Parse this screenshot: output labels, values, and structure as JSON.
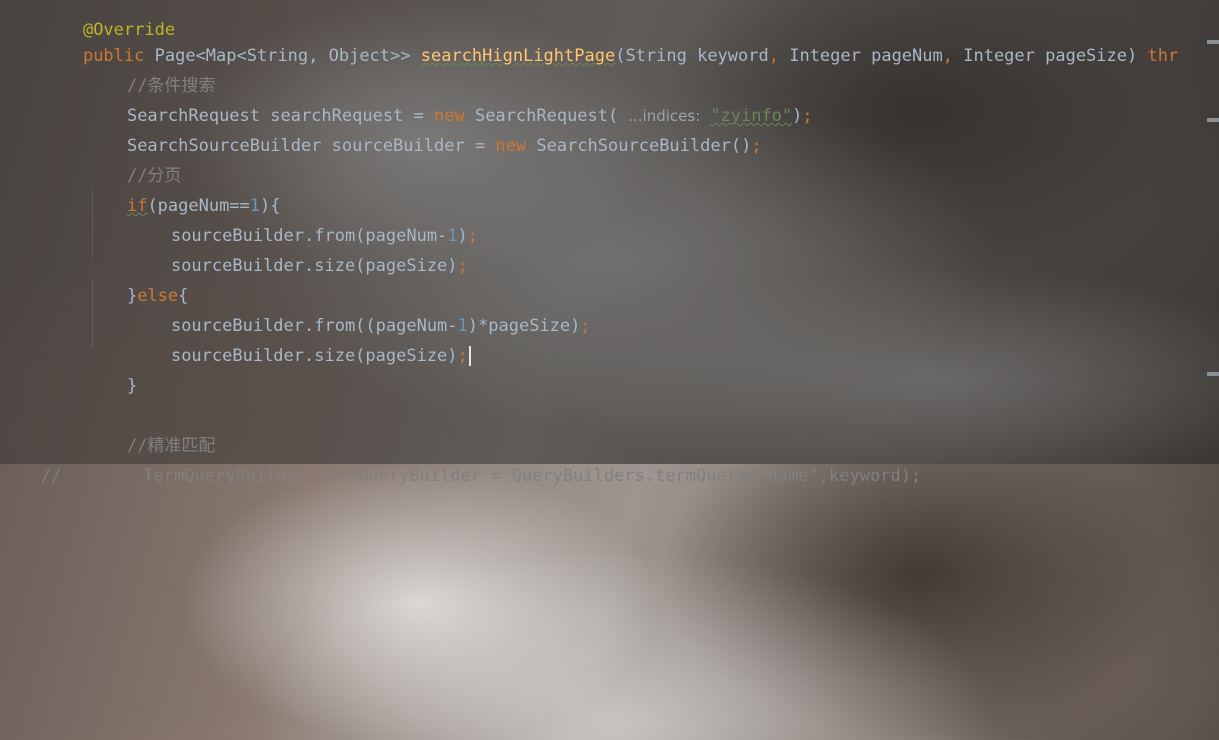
{
  "editor": {
    "lines": [
      {
        "id": "l0",
        "top_text": "@Override"
      },
      {
        "id": "l1"
      },
      {
        "id": "l2"
      },
      {
        "id": "l3"
      },
      {
        "id": "l4"
      },
      {
        "id": "l5"
      },
      {
        "id": "l6"
      },
      {
        "id": "l7"
      },
      {
        "id": "l8"
      },
      {
        "id": "l9"
      },
      {
        "id": "l10"
      },
      {
        "id": "l11"
      },
      {
        "id": "l12"
      },
      {
        "id": "l13"
      },
      {
        "id": "l14"
      }
    ],
    "annotation": "@Override",
    "line1": {
      "public": "public",
      "page_type": "Page<Map<String, Object>> ",
      "method": "searchHignLightPage",
      "params_open": "(String keyword",
      "comma1": ", ",
      "param2": "Integer pageNum",
      "comma2": ", ",
      "param3": "Integer pageSize) ",
      "throws": "thr"
    },
    "comment_search": "//条件搜索",
    "line3": {
      "text1": "SearchRequest searchRequest = ",
      "new": "new",
      "text2": " SearchRequest(",
      "hint": "...indices:",
      "string": "\"zyinfo\"",
      "close": ")",
      "semi": ";"
    },
    "line4": {
      "text1": "SearchSourceBuilder sourceBuilder = ",
      "new": "new",
      "text2": " SearchSourceBuilder()",
      "semi": ";"
    },
    "comment_page": "//分页",
    "line6": {
      "if": "if",
      "text1": "(pageNum==",
      "num": "1",
      "text2": "){"
    },
    "line7": {
      "text1": "sourceBuilder.from(pageNum-",
      "num": "1",
      "text2": ")",
      "semi": ";"
    },
    "line8": {
      "text1": "sourceBuilder.size(pageSize)",
      "semi": ";"
    },
    "line9": {
      "brace": "}",
      "else": "else",
      "open": "{"
    },
    "line10": {
      "text1": "sourceBuilder.from((pageNum-",
      "num": "1",
      "text2": ")*pageSize)",
      "semi": ";"
    },
    "line11": {
      "text1": "sourceBuilder.size(pageSize)",
      "semi": ";"
    },
    "line12": {
      "brace": "}"
    },
    "comment_exact": "//精准匹配",
    "line14": {
      "prefix": "//",
      "text": "        TermQueryBuilder termQueryBuilder = QueryBuilders.termQuery(\"name\",keyword);"
    }
  }
}
